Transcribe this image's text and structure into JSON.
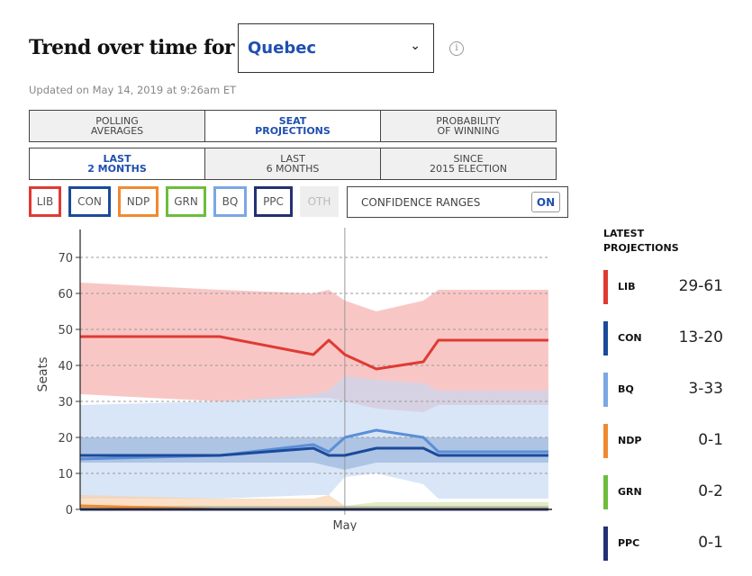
{
  "header": {
    "title": "Trend over time for",
    "region_selected": "Quebec",
    "info_icon": "info-icon",
    "chevron_icon": "chevron-down-icon",
    "updated": "Updated on May 14, 2019 at 9:26am ET"
  },
  "metric_tabs": [
    {
      "line1": "POLLING",
      "line2": "AVERAGES",
      "active": false
    },
    {
      "line1": "SEAT",
      "line2": "PROJECTIONS",
      "active": true
    },
    {
      "line1": "PROBABILITY",
      "line2": "OF WINNING",
      "active": false
    }
  ],
  "range_tabs": [
    {
      "line1": "LAST",
      "line2": "2 MONTHS",
      "active": true
    },
    {
      "line1": "LAST",
      "line2": "6 MONTHS",
      "active": false
    },
    {
      "line1": "SINCE",
      "line2": "2015 ELECTION",
      "active": false
    }
  ],
  "party_toggles": [
    {
      "label": "LIB",
      "color": "#e03a33",
      "on": true
    },
    {
      "label": "CON",
      "color": "#1b4a9a",
      "on": true
    },
    {
      "label": "NDP",
      "color": "#f08a30",
      "on": true
    },
    {
      "label": "GRN",
      "color": "#6cbd3b",
      "on": true
    },
    {
      "label": "BQ",
      "color": "#7ba7e3",
      "on": true
    },
    {
      "label": "PPC",
      "color": "#233072",
      "on": true
    },
    {
      "label": "OTH",
      "color": "#cccccc",
      "on": false
    }
  ],
  "confidence": {
    "label": "CONFIDENCE RANGES",
    "state": "ON"
  },
  "latest": {
    "title_line1": "LATEST",
    "title_line2": "PROJECTIONS",
    "items": [
      {
        "party": "LIB",
        "range": "29-61",
        "color": "#e03a33"
      },
      {
        "party": "CON",
        "range": "13-20",
        "color": "#1b4a9a"
      },
      {
        "party": "BQ",
        "range": "3-33",
        "color": "#7ba7e3"
      },
      {
        "party": "NDP",
        "range": "0-1",
        "color": "#f08a30"
      },
      {
        "party": "GRN",
        "range": "0-2",
        "color": "#6cbd3b"
      },
      {
        "party": "PPC",
        "range": "0-1",
        "color": "#233072"
      }
    ]
  },
  "chart_data": {
    "type": "line",
    "title": "Trend over time for Quebec",
    "xlabel": "",
    "ylabel": "Seats",
    "ylim": [
      0,
      75
    ],
    "yticks": [
      0,
      10,
      20,
      30,
      40,
      50,
      60,
      70
    ],
    "x_domain": [
      0,
      100
    ],
    "x_tick_labels": [
      {
        "x": 56.3,
        "label": "May"
      }
    ],
    "grid": true,
    "x": [
      0,
      29.7,
      49.6,
      52.9,
      56.3,
      63.0,
      73.0,
      76.2,
      99.6
    ],
    "series": [
      {
        "name": "LIB",
        "color": "#e03a33",
        "band_color": "#f4a9a6",
        "values": [
          48,
          48,
          43,
          47,
          43,
          39,
          41,
          47,
          47
        ],
        "lower": [
          32,
          30,
          31,
          31,
          30,
          28,
          27,
          29,
          29
        ],
        "upper": [
          63,
          61,
          60,
          61,
          58,
          55,
          58,
          61,
          61
        ]
      },
      {
        "name": "BQ",
        "color": "#5b8fd8",
        "band_color": "#c4d8f3",
        "values": [
          14,
          15,
          18,
          16,
          20,
          22,
          20,
          16,
          16
        ],
        "lower": [
          3,
          3,
          4,
          4,
          9,
          10,
          7,
          3,
          3
        ],
        "upper": [
          29,
          30,
          32,
          33,
          37,
          36,
          35,
          33,
          33
        ]
      },
      {
        "name": "CON",
        "color": "#1b4a9a",
        "band_color": "#9bb5dc",
        "values": [
          15,
          15,
          17,
          15,
          15,
          17,
          17,
          15,
          15
        ],
        "lower": [
          13,
          13,
          13,
          12,
          11,
          13,
          13,
          13,
          13
        ],
        "upper": [
          20,
          20,
          20,
          20,
          20,
          20,
          20,
          20,
          20
        ]
      },
      {
        "name": "NDP",
        "color": "#f08a30",
        "band_color": "#f9cfa8",
        "values": [
          1,
          0,
          0,
          0,
          0,
          0,
          0,
          0,
          0
        ],
        "lower": [
          0,
          0,
          0,
          0,
          0,
          0,
          0,
          0,
          0
        ],
        "upper": [
          4,
          3,
          3,
          4,
          1,
          1,
          1,
          1,
          1
        ]
      },
      {
        "name": "GRN",
        "color": "#6cbd3b",
        "band_color": "#cfe3a8",
        "values": [
          0,
          0,
          0,
          0,
          0,
          0,
          0,
          0,
          0
        ],
        "lower": [
          0,
          0,
          0,
          0,
          0,
          0,
          0,
          0,
          0
        ],
        "upper": [
          1,
          1,
          1,
          1,
          1,
          2,
          2,
          2,
          2
        ]
      },
      {
        "name": "PPC",
        "color": "#233072",
        "band_color": "#b9b2a3",
        "values": [
          0,
          0,
          0,
          0,
          0,
          0,
          0,
          0,
          0
        ],
        "lower": [
          0,
          0,
          0,
          0,
          0,
          0,
          0,
          0,
          0
        ],
        "upper": [
          1,
          1,
          1,
          1,
          1,
          1,
          1,
          1,
          1
        ]
      }
    ]
  }
}
